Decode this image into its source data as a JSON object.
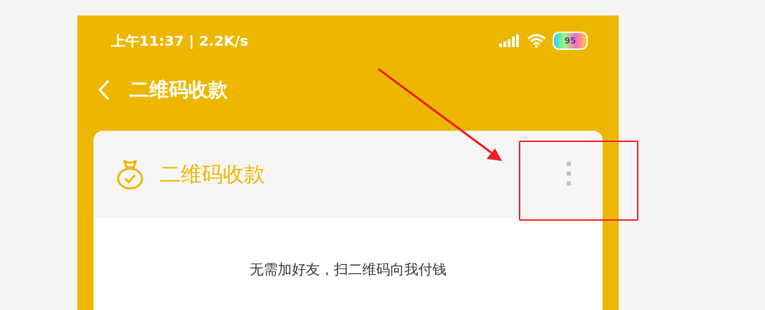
{
  "status_bar": {
    "time": "上午11:37 | 2.2K/s",
    "battery": "95"
  },
  "header": {
    "title": "二维码收款"
  },
  "card": {
    "title": "二维码收款",
    "message": "无需加好友，扫二维码向我付钱"
  },
  "annotations": [
    {
      "kind": "arrow"
    },
    {
      "kind": "frame"
    }
  ]
}
